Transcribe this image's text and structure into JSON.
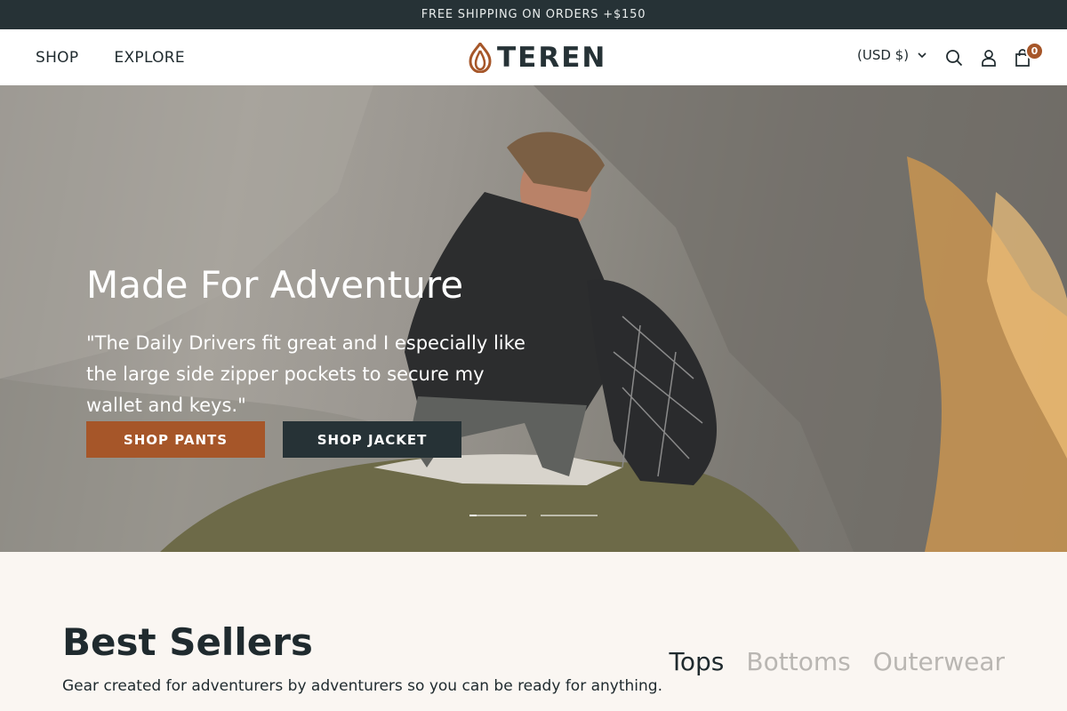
{
  "announcement": {
    "text": "FREE SHIPPING ON ORDERS +$150"
  },
  "header": {
    "nav": [
      {
        "label": "SHOP"
      },
      {
        "label": "EXPLORE"
      }
    ],
    "logo_text": "TEREN",
    "currency": "(USD $)",
    "icons": [
      "search-icon",
      "account-icon",
      "cart-icon"
    ],
    "cart_count": "0"
  },
  "hero": {
    "title": "Made For Adventure",
    "quote": "\"The Daily Drivers fit great and I especially like the large side zipper pockets to secure my wallet and keys.\"",
    "buttons": [
      {
        "label": "SHOP PANTS"
      },
      {
        "label": "SHOP JACKET"
      }
    ],
    "slides_count": 2,
    "active_slide": 1
  },
  "best_sellers": {
    "title": "Best Sellers",
    "subtitle": "Gear created for adventurers by adventurers so you can be ready for anything.",
    "tabs": [
      {
        "label": "Tops",
        "active": true
      },
      {
        "label": "Bottoms",
        "active": false
      },
      {
        "label": "Outerwear",
        "active": false
      }
    ]
  },
  "colors": {
    "accent": "#a65629",
    "dark": "#263236",
    "background": "#faf6f2"
  }
}
